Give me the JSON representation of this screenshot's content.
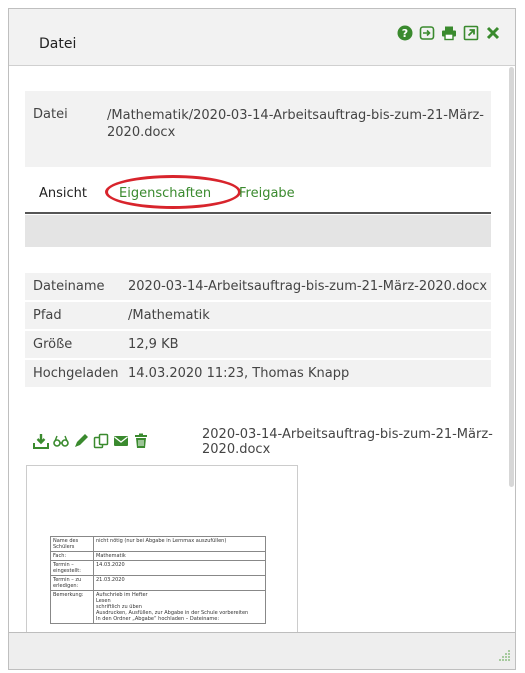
{
  "header": {
    "title": "Datei",
    "icons": [
      "help-icon",
      "open-in-icon",
      "print-icon",
      "external-link-icon",
      "close-icon"
    ]
  },
  "file": {
    "label": "Datei",
    "path": "/Mathematik/2020-03-14-Arbeitsauftrag-bis-zum-21-März-2020.docx"
  },
  "tabs": [
    {
      "label": "Ansicht",
      "active": true
    },
    {
      "label": "Eigenschaften",
      "highlighted": true
    },
    {
      "label": "Freigabe"
    }
  ],
  "properties": [
    {
      "key": "Dateiname",
      "value": "2020-03-14-Arbeitsauftrag-bis-zum-21-März-2020.docx"
    },
    {
      "key": "Pfad",
      "value": "/Mathematik"
    },
    {
      "key": "Größe",
      "value": "12,9 KB"
    },
    {
      "key": "Hochgeladen",
      "value": "14.03.2020 11:23, Thomas Knapp"
    }
  ],
  "actions": {
    "icons": [
      "download-icon",
      "view-icon",
      "edit-icon",
      "copy-icon",
      "email-icon",
      "delete-icon"
    ],
    "filename": "2020-03-14-Arbeitsauftrag-bis-zum-21-März-2020.docx"
  },
  "preview": {
    "rows": [
      {
        "k": "Name des Schülers",
        "v": "nicht nötig (nur bei Abgabe in Lernmax auszufüllen)"
      },
      {
        "k": "Fach:",
        "v": "Mathematik"
      },
      {
        "k": "Termin – eingestellt:",
        "v": "14.03.2020"
      },
      {
        "k": "Termin – zu erledigen:",
        "v": "21.03.2020"
      },
      {
        "k": "Bemerkung:",
        "v": "Aufschrieb im Hefter\nLesen\nschriftlich zu üben\nAusdrucken, Ausfüllen, zur Abgabe in der Schule vorbereiten\nIn den Ordner „Abgabe“ hochladen – Dateiname:"
      }
    ]
  },
  "colors": {
    "accent": "#3a8a2e",
    "highlight": "#d8242c"
  }
}
